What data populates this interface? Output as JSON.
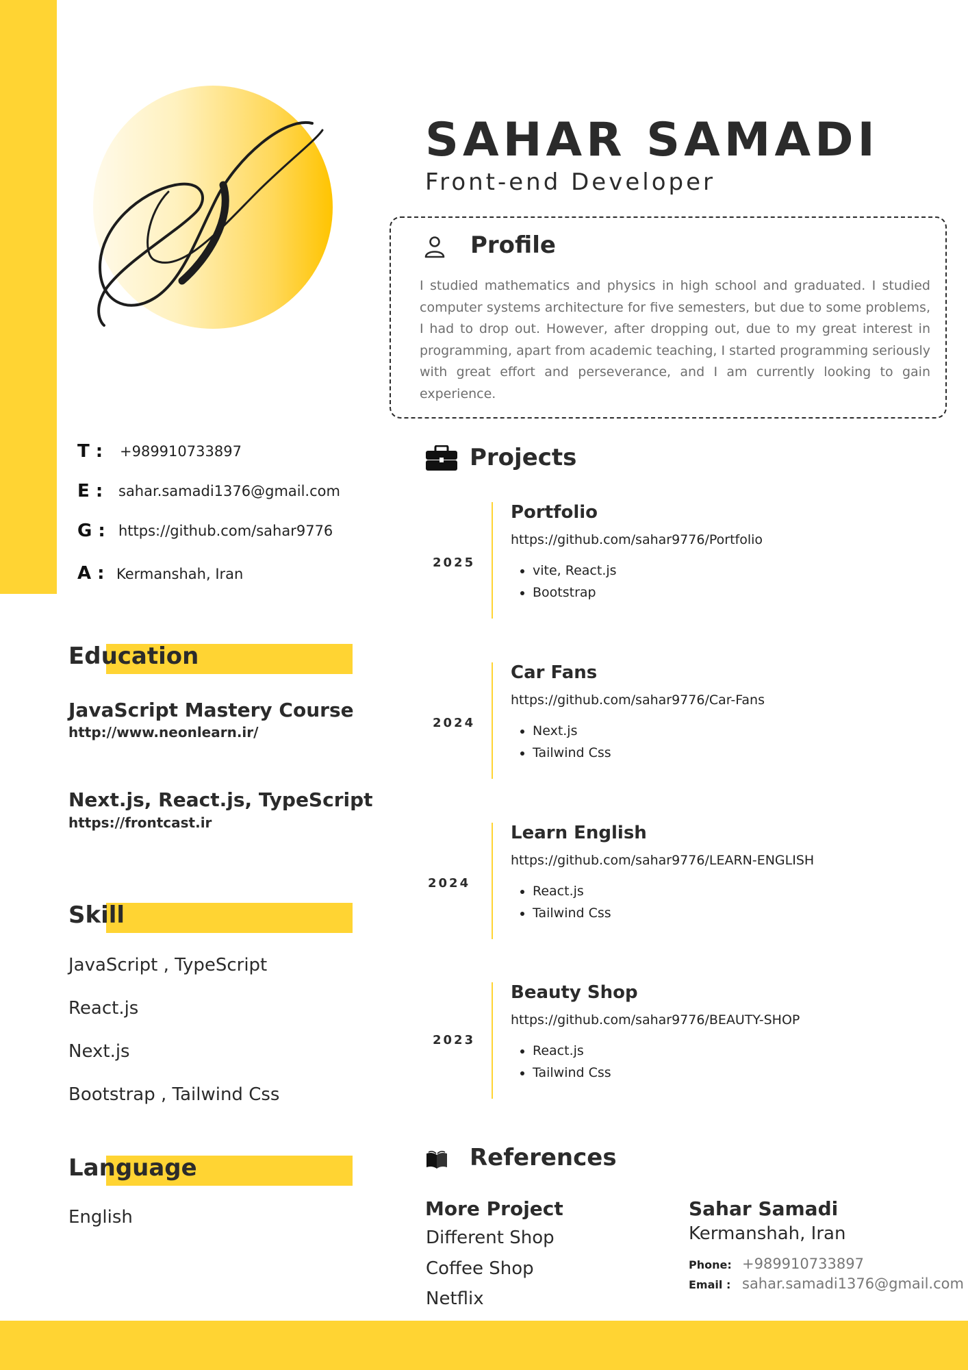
{
  "header": {
    "name": "SAHAR SAMADI",
    "job_title": "Front-end Developer"
  },
  "profile": {
    "title": "Profile",
    "icon": "user-icon",
    "text": "I studied mathematics and physics in high school and graduated. I studied computer systems architecture for five semesters, but due to some problems, I had to drop out. However, after dropping out, due to my great interest in programming, apart from academic teaching, I started programming seriously with great effort and perseverance, and I am currently looking to gain experience."
  },
  "contacts": [
    {
      "key": "T :",
      "value": "+989910733897"
    },
    {
      "key": "E :",
      "value": "sahar.samadi1376@gmail.com"
    },
    {
      "key": "G :",
      "value": "https://github.com/sahar9776"
    },
    {
      "key": "A :",
      "value": "Kermanshah, Iran"
    }
  ],
  "education": {
    "title": "Education",
    "items": [
      {
        "title": "JavaScript Mastery Course",
        "link": "http://www.neonlearn.ir/"
      },
      {
        "title": "Next.js, React.js, TypeScript",
        "link": "https://frontcast.ir"
      }
    ]
  },
  "skills": {
    "title": "Skill",
    "items": [
      "JavaScript , TypeScript",
      "React.js",
      "Next.js",
      "Bootstrap , Tailwind Css"
    ]
  },
  "language": {
    "title": "Language",
    "items": [
      "English"
    ]
  },
  "projects": {
    "title": "Projects",
    "icon": "briefcase-icon",
    "items": [
      {
        "year": "2025",
        "title": "Portfolio",
        "link": "https://github.com/sahar9776/Portfolio",
        "tags": [
          "vite, React.js",
          "Bootstrap"
        ]
      },
      {
        "year": "2024",
        "title": "Car Fans",
        "link": "https://github.com/sahar9776/Car-Fans",
        "tags": [
          "Next.js",
          "Tailwind Css"
        ]
      },
      {
        "year": "2024",
        "title": "Learn English",
        "link": "https://github.com/sahar9776/LEARN-ENGLISH",
        "tags": [
          "React.js",
          "Tailwind Css"
        ]
      },
      {
        "year": "2023",
        "title": "Beauty Shop",
        "link": "https://github.com/sahar9776/BEAUTY-SHOP",
        "tags": [
          "React.js",
          "Tailwind Css"
        ]
      }
    ]
  },
  "references": {
    "title": "References",
    "icon": "book-icon",
    "more_title": "More Project",
    "more_items": [
      "Different Shop",
      "Coffee Shop",
      "Netflix"
    ],
    "person": {
      "name": "Sahar Samadi",
      "city": "Kermanshah, Iran",
      "phone_label": "Phone:",
      "phone": "+989910733897",
      "email_label": "Email :",
      "email": "sahar.samadi1376@gmail.com"
    }
  },
  "colors": {
    "accent": "#FFD433",
    "text": "#2b2b2b",
    "muted": "#6e6e6e"
  }
}
